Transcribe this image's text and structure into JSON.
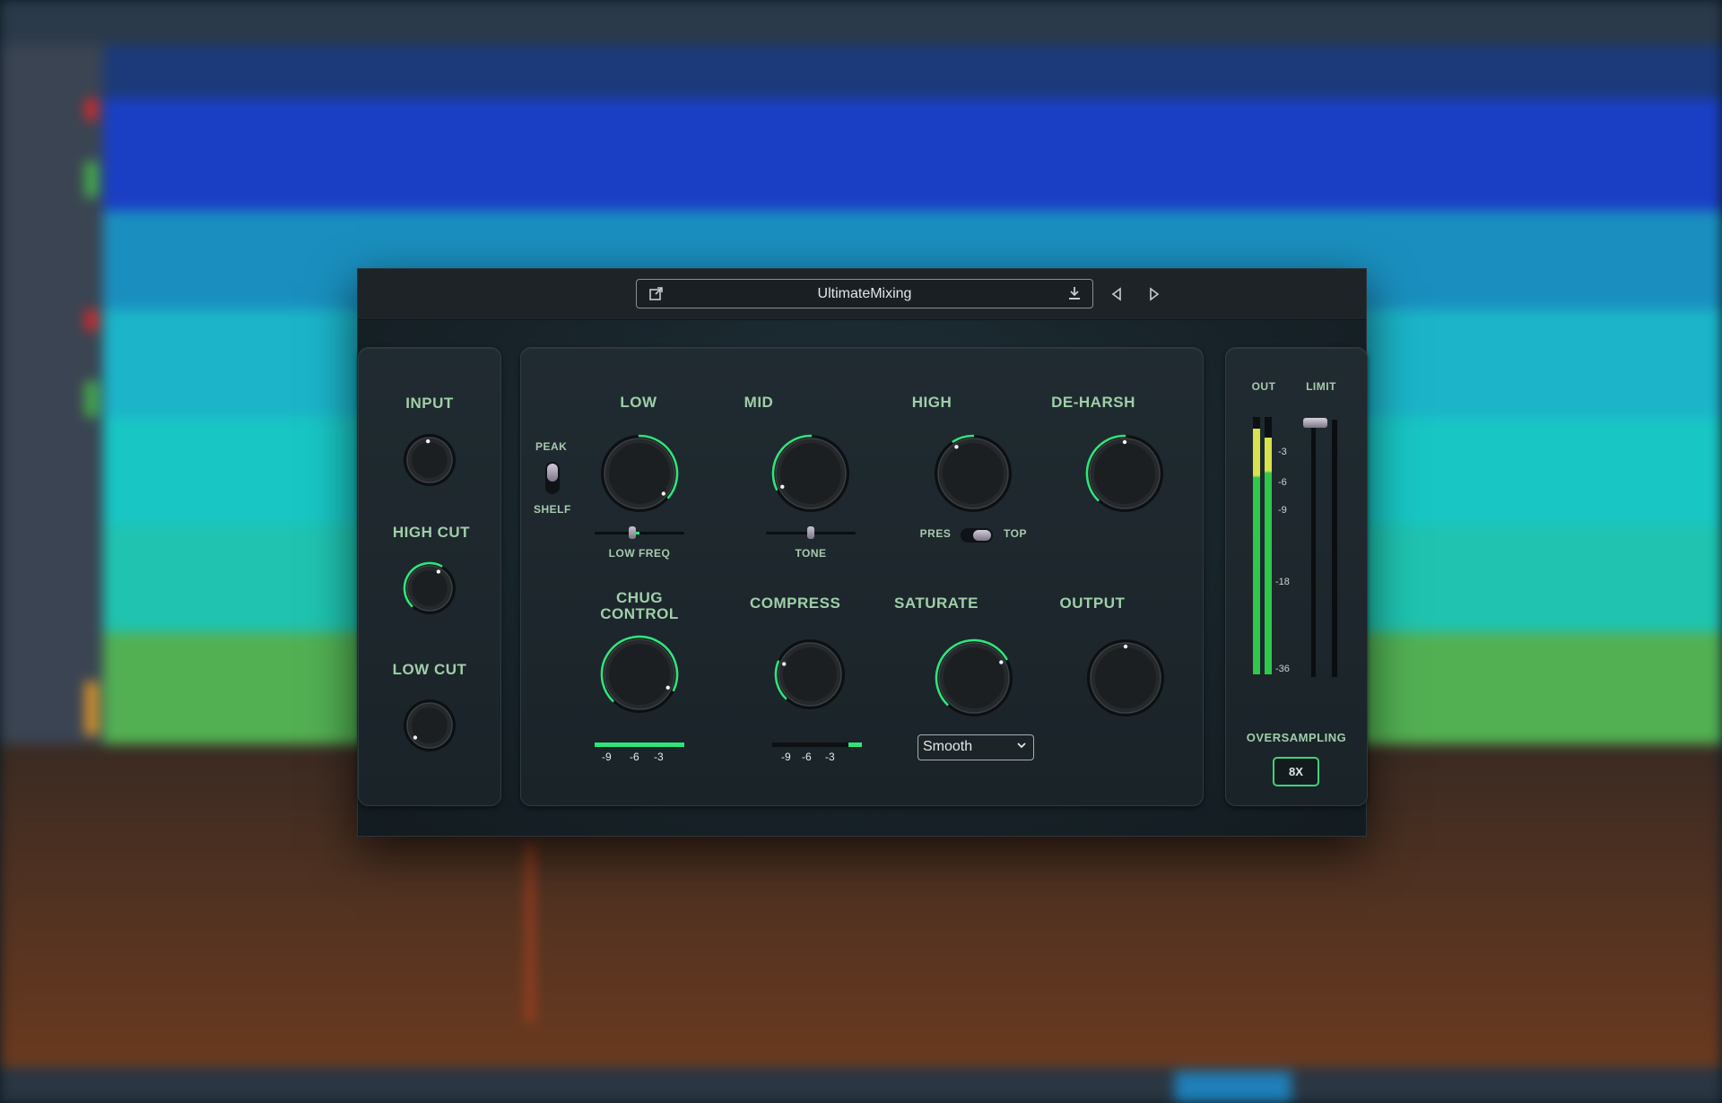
{
  "preset": {
    "name": "UltimateMixing"
  },
  "io_panel": {
    "input_label": "INPUT",
    "high_cut_label": "HIGH CUT",
    "low_cut_label": "LOW CUT"
  },
  "eq": {
    "low_label": "LOW",
    "mid_label": "MID",
    "high_label": "HIGH",
    "deharsh_label": "DE-HARSH",
    "peak_label": "PEAK",
    "shelf_label": "SHELF",
    "low_freq_label": "LOW FREQ",
    "tone_label": "TONE",
    "pres_label": "PRES",
    "top_label": "TOP"
  },
  "dynamics": {
    "chug_label_1": "CHUG",
    "chug_label_2": "CONTROL",
    "compress_label": "COMPRESS",
    "saturate_label": "SATURATE",
    "output_label": "OUTPUT",
    "saturate_mode": "Smooth",
    "chug_ticks": [
      "-9",
      "-6",
      "-3"
    ],
    "compress_ticks": [
      "-9",
      "-6",
      "-3"
    ]
  },
  "meter": {
    "out_label": "OUT",
    "limit_label": "LIMIT",
    "scale": [
      "-3",
      "-6",
      "-9",
      "-18",
      "-36"
    ],
    "oversampling_label": "OVERSAMPLING",
    "oversampling_value": "8X"
  },
  "colors": {
    "accent": "#2fe57a",
    "label": "#9fcfa8",
    "meter_green": "#2ec84a",
    "meter_yellow": "#d8e24a"
  },
  "icons": {
    "export": "external-link-icon",
    "save": "download-icon",
    "prev": "triangle-left-icon",
    "next": "triangle-right-icon"
  }
}
